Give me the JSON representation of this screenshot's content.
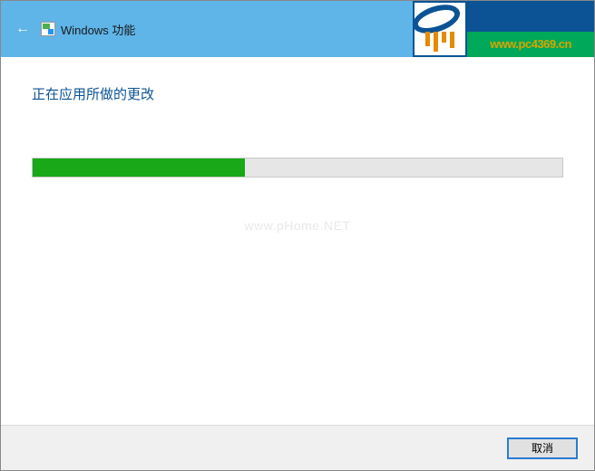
{
  "titlebar": {
    "title": "Windows 功能"
  },
  "logo": {
    "url_text": "www.pc4369.cn"
  },
  "content": {
    "heading": "正在应用所做的更改",
    "progress_percent": 40
  },
  "watermark": "www.pHome.NET",
  "footer": {
    "cancel_label": "取消"
  }
}
